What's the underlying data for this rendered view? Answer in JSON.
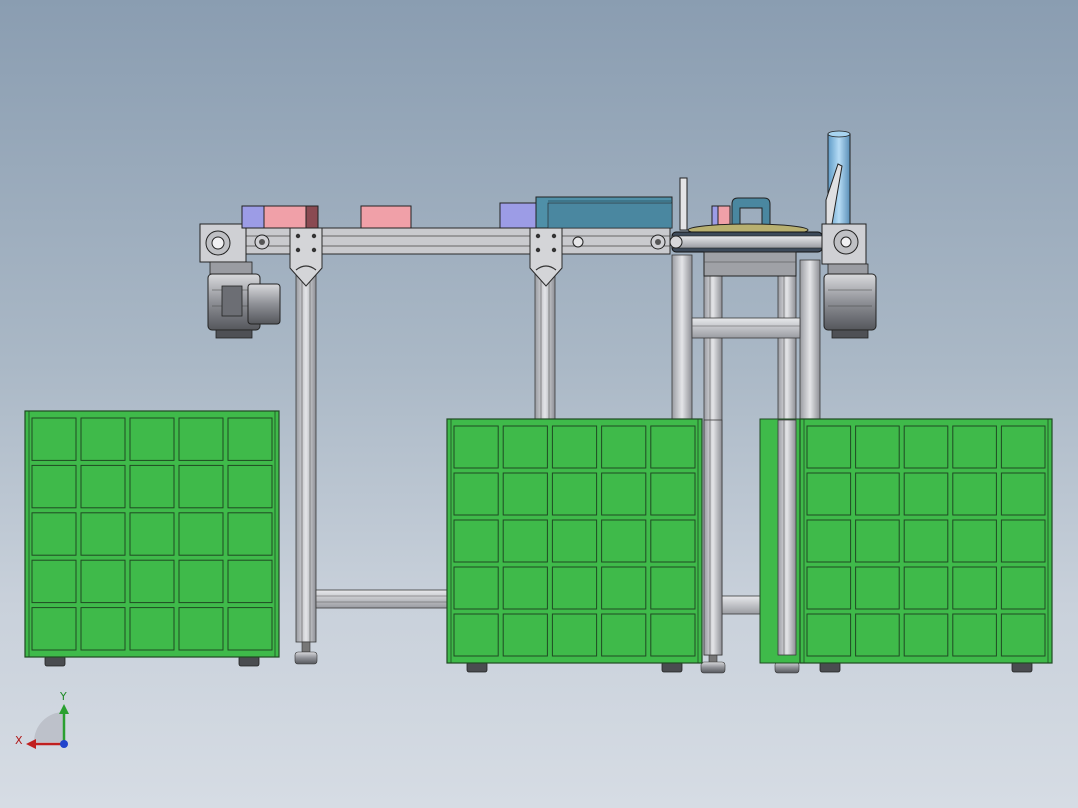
{
  "viewport": {
    "background_top": "#8a9db1",
    "background_bottom": "#d6dce4"
  },
  "colors": {
    "pallet_green": "#3fba4a",
    "frame_gray": "#c8c8cc",
    "motor_gray": "#8e9096",
    "box_pink": "#f0a0a8",
    "box_purple": "#9c9ce6",
    "box_teal": "#4f90a8",
    "pipe_blue": "#7fb8e0",
    "turntable_olive": "#b8b070"
  },
  "icons": {
    "triad": "coordinate-triad-icon"
  },
  "triad": {
    "x_label": "X",
    "y_label": "Y"
  },
  "pallets": {
    "rows": 5,
    "cols": 5,
    "count": 3
  }
}
